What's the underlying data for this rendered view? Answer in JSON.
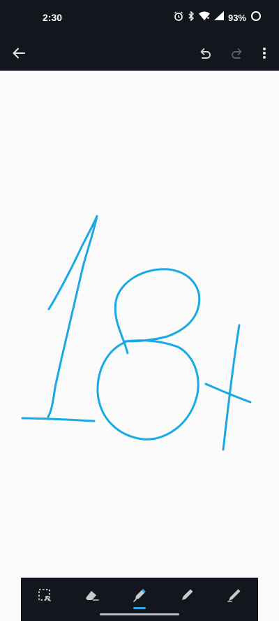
{
  "status": {
    "time": "2:30",
    "battery": "93%",
    "icons": [
      "alarm-icon",
      "bluetooth-icon",
      "wifi-icon",
      "signal-icon",
      "battery-ring-icon"
    ]
  },
  "toolbar": {
    "back_icon": "arrow-left-icon",
    "undo_icon": "undo-icon",
    "redo_icon": "redo-icon",
    "redo_enabled": false,
    "more_icon": "more-vertical-icon"
  },
  "canvas": {
    "ink_color": "#1aa9e4",
    "background": "#fbfbfb"
  },
  "tools": [
    {
      "name": "lasso-select",
      "icon": "lasso-select-icon",
      "active": false
    },
    {
      "name": "eraser",
      "icon": "eraser-icon",
      "active": false
    },
    {
      "name": "pen",
      "icon": "pen-icon",
      "active": true
    },
    {
      "name": "pencil",
      "icon": "pencil-icon",
      "active": false
    },
    {
      "name": "marker",
      "icon": "marker-icon",
      "active": false
    }
  ],
  "colors": {
    "bar_background": "#14161d",
    "icon_default": "#c8cacf",
    "icon_disabled": "#5a5d63",
    "active_accent": "#29a8e8"
  }
}
